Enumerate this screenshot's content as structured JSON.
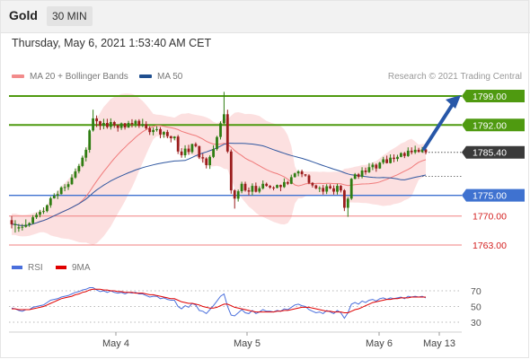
{
  "header": {
    "title": "Gold",
    "timeframe": "30 MIN"
  },
  "datetime": "Thursday, May 6, 2021 1:53:40 AM CET",
  "legend": {
    "bollinger": {
      "label": "MA 20 + Bollinger Bands",
      "color": "#f28b8b"
    },
    "ma50": {
      "label": "MA 50",
      "color": "#1f4f8f"
    }
  },
  "credit": "Research © 2021 Trading Central",
  "rsi_legend": {
    "rsi": {
      "label": "RSI",
      "color": "#4a6fdc"
    },
    "ma9": {
      "label": "9MA",
      "color": "#e00000"
    }
  },
  "colors": {
    "resistance": "#4f9a10",
    "support": "#3f72d0",
    "support_minor": "#f08080",
    "candle_up": "#2f7d12",
    "candle_down": "#9b1d1d",
    "arrow": "#2757a8",
    "band_fill": "#fbdada"
  },
  "chart_data": {
    "type": "candlestick",
    "instrument": "Gold",
    "interval": "30 MIN",
    "y_range": [
      1759,
      1802
    ],
    "x_labels": [
      "May 4",
      "May 5",
      "May 6",
      "May 13"
    ],
    "candles": [
      [
        1769,
        1768,
        1767,
        1770
      ],
      [
        1768,
        1768,
        1766,
        1769
      ],
      [
        1767.0,
        1767.3,
        1766.2,
        1768.1
      ],
      [
        1767.3,
        1767.4,
        1766.5,
        1768.1
      ],
      [
        1767.4,
        1767.9,
        1767.2,
        1769.2
      ],
      [
        1767.9,
        1768.3,
        1767.4,
        1768.5
      ],
      [
        1768.3,
        1769.7,
        1768.0,
        1770.2
      ],
      [
        1769.7,
        1770.3,
        1769.3,
        1770.8
      ],
      [
        1770.3,
        1771.0,
        1769.7,
        1771.5
      ],
      [
        1771.0,
        1771.2,
        1770.5,
        1772.1
      ],
      [
        1771.2,
        1772.6,
        1770.9,
        1772.8
      ],
      [
        1772.6,
        1774.3,
        1772.0,
        1774.7
      ],
      [
        1774.3,
        1774.9,
        1774.2,
        1775.5
      ],
      [
        1774.9,
        1775.3,
        1774.1,
        1776.1
      ],
      [
        1775.3,
        1776.9,
        1775.2,
        1777.2
      ],
      [
        1776.9,
        1777.0,
        1776.0,
        1777.7
      ],
      [
        1777.0,
        1777.7,
        1776.3,
        1778.3
      ],
      [
        1777.7,
        1779.3,
        1777.5,
        1780.1
      ],
      [
        1779.3,
        1780.8,
        1779.0,
        1781.5
      ],
      [
        1780.8,
        1782.1,
        1780.3,
        1782.6
      ],
      [
        1782.1,
        1784.1,
        1781.8,
        1784.6
      ],
      [
        1784.1,
        1786.0,
        1783.2,
        1786.6
      ],
      [
        1786.0,
        1790.7,
        1785.3,
        1791.0
      ],
      [
        1790.7,
        1793.6,
        1790.4,
        1795.7
      ],
      [
        1793.6,
        1792.9,
        1791.5,
        1794.3
      ],
      [
        1792.9,
        1791.8,
        1790.8,
        1793.0
      ],
      [
        1791.8,
        1792.5,
        1791.0,
        1793.5
      ],
      [
        1792.5,
        1791.5,
        1791.1,
        1793.5
      ],
      [
        1791.5,
        1792.7,
        1790.9,
        1793.6
      ],
      [
        1792.7,
        1791.9,
        1791.3,
        1793.0
      ],
      [
        1791.9,
        1791.3,
        1790.4,
        1792.1
      ],
      [
        1791.3,
        1792.4,
        1790.8,
        1792.6
      ],
      [
        1792.4,
        1791.4,
        1790.9,
        1792.5
      ],
      [
        1791.4,
        1792.5,
        1791.3,
        1793.0
      ],
      [
        1792.5,
        1792.2,
        1791.4,
        1793.4
      ],
      [
        1792.2,
        1793.0,
        1791.4,
        1793.3
      ],
      [
        1793.0,
        1791.8,
        1791.3,
        1793.4
      ],
      [
        1791.8,
        1792.2,
        1791.5,
        1793.5
      ],
      [
        1792.2,
        1791.2,
        1790.9,
        1792.9
      ],
      [
        1791.2,
        1790.3,
        1789.6,
        1791.7
      ],
      [
        1790.3,
        1790.8,
        1789.5,
        1791.4
      ],
      [
        1790.8,
        1791.0,
        1790.4,
        1791.7
      ],
      [
        1791.0,
        1789.7,
        1788.8,
        1791.5
      ],
      [
        1789.7,
        1790.3,
        1788.9,
        1790.5
      ],
      [
        1790.3,
        1789.3,
        1788.8,
        1790.8
      ],
      [
        1789.3,
        1788.8,
        1787.8,
        1789.4
      ],
      [
        1788.8,
        1789.2,
        1788.3,
        1789.3
      ],
      [
        1789.2,
        1785.6,
        1785.0,
        1789.6
      ],
      [
        1785.6,
        1784.7,
        1784.1,
        1786.4
      ],
      [
        1784.7,
        1786.3,
        1784.1,
        1787.1
      ],
      [
        1786.3,
        1785.5,
        1784.8,
        1787.2
      ],
      [
        1785.5,
        1787.4,
        1785.1,
        1787.5
      ],
      [
        1787.4,
        1786.9,
        1786.6,
        1787.8
      ],
      [
        1786.9,
        1784.2,
        1783.8,
        1787.0
      ],
      [
        1784.2,
        1783.9,
        1782.9,
        1785.1
      ],
      [
        1783.9,
        1782.3,
        1781.5,
        1784.2
      ],
      [
        1782.3,
        1784.3,
        1781.4,
        1784.7
      ],
      [
        1784.3,
        1786.2,
        1784.0,
        1787.1
      ],
      [
        1786.2,
        1789.1,
        1785.8,
        1789.4
      ],
      [
        1789.1,
        1792.4,
        1788.5,
        1792.9
      ],
      [
        1792.4,
        1794.6,
        1792.2,
        1800.0
      ],
      [
        1794.6,
        1785.6,
        1785.2,
        1795.7
      ],
      [
        1785.6,
        1776.2,
        1775.4,
        1786.1
      ],
      [
        1776.2,
        1774.2,
        1771.8,
        1776.5
      ],
      [
        1774.2,
        1776.0,
        1773.5,
        1776.4
      ],
      [
        1776.0,
        1777.8,
        1775.5,
        1778.3
      ],
      [
        1777.8,
        1776.2,
        1775.9,
        1778.3
      ],
      [
        1776.2,
        1775.9,
        1775.0,
        1776.9
      ],
      [
        1775.9,
        1777.3,
        1775.0,
        1777.9
      ],
      [
        1777.3,
        1775.9,
        1775.7,
        1778.1
      ],
      [
        1775.9,
        1776.7,
        1775.5,
        1777.2
      ],
      [
        1776.7,
        1777.8,
        1776.4,
        1778.6
      ],
      [
        1777.8,
        1777.3,
        1777.1,
        1778.1
      ],
      [
        1777.3,
        1776.9,
        1776.6,
        1777.5
      ],
      [
        1776.9,
        1776.8,
        1776.2,
        1777.2
      ],
      [
        1776.8,
        1777.5,
        1776.7,
        1777.6
      ],
      [
        1777.5,
        1777.0,
        1776.0,
        1777.6
      ],
      [
        1777.0,
        1778.2,
        1776.8,
        1779.1
      ],
      [
        1778.2,
        1777.8,
        1777.5,
        1778.5
      ],
      [
        1777.8,
        1779.4,
        1777.7,
        1780.0
      ],
      [
        1779.4,
        1780.3,
        1779.3,
        1780.5
      ],
      [
        1780.3,
        1780.8,
        1779.6,
        1781.1
      ],
      [
        1780.8,
        1780.1,
        1779.4,
        1781.2
      ],
      [
        1780.1,
        1779.8,
        1779.5,
        1780.1
      ],
      [
        1779.8,
        1778.0,
        1777.7,
        1780.1
      ],
      [
        1778.0,
        1777.4,
        1776.9,
        1778.2
      ],
      [
        1777.4,
        1776.7,
        1776.5,
        1777.6
      ],
      [
        1776.7,
        1776.8,
        1775.8,
        1777.2
      ],
      [
        1776.8,
        1775.9,
        1775.2,
        1777.5
      ],
      [
        1775.9,
        1777.2,
        1775.3,
        1777.7
      ],
      [
        1777.2,
        1776.7,
        1776.5,
        1777.7
      ],
      [
        1776.7,
        1775.9,
        1775.2,
        1777.4
      ],
      [
        1775.9,
        1777.3,
        1775.2,
        1777.8
      ],
      [
        1777.3,
        1776.2,
        1775.7,
        1777.5
      ],
      [
        1776.2,
        1772.0,
        1771.2,
        1776.5
      ],
      [
        1772.0,
        1774.2,
        1769.8,
        1774.6
      ],
      [
        1774.2,
        1779.0,
        1773.9,
        1779.2
      ],
      [
        1779.0,
        1780.1,
        1778.9,
        1780.4
      ],
      [
        1780.1,
        1779.5,
        1779.0,
        1780.4
      ],
      [
        1779.5,
        1781.0,
        1779.1,
        1781.8
      ],
      [
        1781.0,
        1780.6,
        1780.0,
        1781.7
      ],
      [
        1780.6,
        1781.8,
        1780.4,
        1782.8
      ],
      [
        1781.8,
        1782.4,
        1781.1,
        1782.9
      ],
      [
        1782.4,
        1781.5,
        1780.7,
        1782.7
      ],
      [
        1781.5,
        1782.9,
        1781.4,
        1783.1
      ],
      [
        1782.9,
        1783.7,
        1782.5,
        1784.3
      ],
      [
        1783.7,
        1782.8,
        1782.7,
        1784.6
      ],
      [
        1782.8,
        1784.1,
        1782.7,
        1784.9
      ],
      [
        1784.1,
        1783.8,
        1783.0,
        1784.9
      ],
      [
        1783.8,
        1784.3,
        1783.2,
        1784.8
      ],
      [
        1784.3,
        1785.2,
        1784.2,
        1785.4
      ],
      [
        1785.2,
        1784.5,
        1784.0,
        1785.5
      ],
      [
        1784.5,
        1785.8,
        1784.3,
        1786.6
      ],
      [
        1785.8,
        1785.4,
        1784.9,
        1786.6
      ],
      [
        1785.4,
        1786.0,
        1785.0,
        1787.0
      ],
      [
        1786.0,
        1785.5,
        1785.3,
        1786.5
      ],
      [
        1785.5,
        1786.1,
        1785.3,
        1786.7
      ],
      [
        1786.1,
        1785.4,
        1784.9,
        1786.5
      ]
    ],
    "levels": [
      {
        "price": 1799.0,
        "label": "1799.00",
        "kind": "resistance"
      },
      {
        "price": 1792.0,
        "label": "1792.00",
        "kind": "resistance"
      },
      {
        "price": 1785.4,
        "label": "1785.40",
        "kind": "current"
      },
      {
        "price": 1775.0,
        "label": "1775.00",
        "kind": "support"
      },
      {
        "price": 1770.0,
        "label": "1770.00",
        "kind": "support_minor"
      },
      {
        "price": 1763.0,
        "label": "1763.00",
        "kind": "support_minor"
      }
    ],
    "forecast_arrow": {
      "from_price": 1785.4,
      "to_price": 1799.0
    },
    "rsi": {
      "range": [
        20,
        80
      ],
      "ticks": [
        70,
        50,
        30
      ],
      "values": [
        48,
        47,
        45,
        44,
        46,
        46,
        49,
        50,
        51,
        52,
        55,
        58,
        59,
        60,
        62,
        63,
        64,
        66,
        68,
        69,
        71,
        72,
        74,
        74,
        71,
        69,
        70,
        68,
        70,
        68,
        67,
        68,
        66,
        68,
        67,
        68,
        66,
        66,
        64,
        62,
        63,
        63,
        60,
        61,
        59,
        58,
        58,
        50,
        47,
        51,
        49,
        54,
        52,
        45,
        44,
        41,
        46,
        51,
        57,
        63,
        66,
        50,
        39,
        38,
        42,
        46,
        42,
        41,
        45,
        41,
        43,
        46,
        44,
        44,
        43,
        45,
        44,
        47,
        46,
        49,
        52,
        53,
        51,
        50,
        46,
        44,
        42,
        43,
        41,
        45,
        43,
        41,
        45,
        42,
        35,
        42,
        53,
        55,
        53,
        57,
        55,
        58,
        59,
        57,
        60,
        61,
        59,
        61,
        60,
        61,
        62,
        60,
        63,
        62,
        63,
        62,
        63,
        61
      ],
      "ma9": [
        47,
        47,
        46,
        46,
        46,
        46,
        47,
        48,
        49,
        50,
        52,
        54,
        56,
        58,
        60,
        61,
        62,
        63,
        65,
        66,
        68,
        69,
        71,
        72,
        72,
        72,
        71,
        71,
        70,
        70,
        69,
        69,
        68,
        68,
        68,
        67,
        67,
        67,
        66,
        65,
        65,
        64,
        63,
        62,
        61,
        60,
        60,
        58,
        56,
        55,
        54,
        54,
        53,
        52,
        50,
        49,
        48,
        48,
        49,
        51,
        53,
        53,
        51,
        49,
        48,
        47,
        46,
        45,
        44,
        43,
        43,
        43,
        43,
        43,
        43,
        44,
        44,
        45,
        45,
        46,
        47,
        48,
        49,
        49,
        49,
        48,
        47,
        46,
        45,
        44,
        44,
        43,
        43,
        43,
        42,
        42,
        44,
        46,
        47,
        49,
        51,
        53,
        55,
        56,
        57,
        58,
        59,
        59,
        60,
        60,
        61,
        61,
        61,
        62,
        62,
        62,
        62,
        62
      ]
    }
  }
}
